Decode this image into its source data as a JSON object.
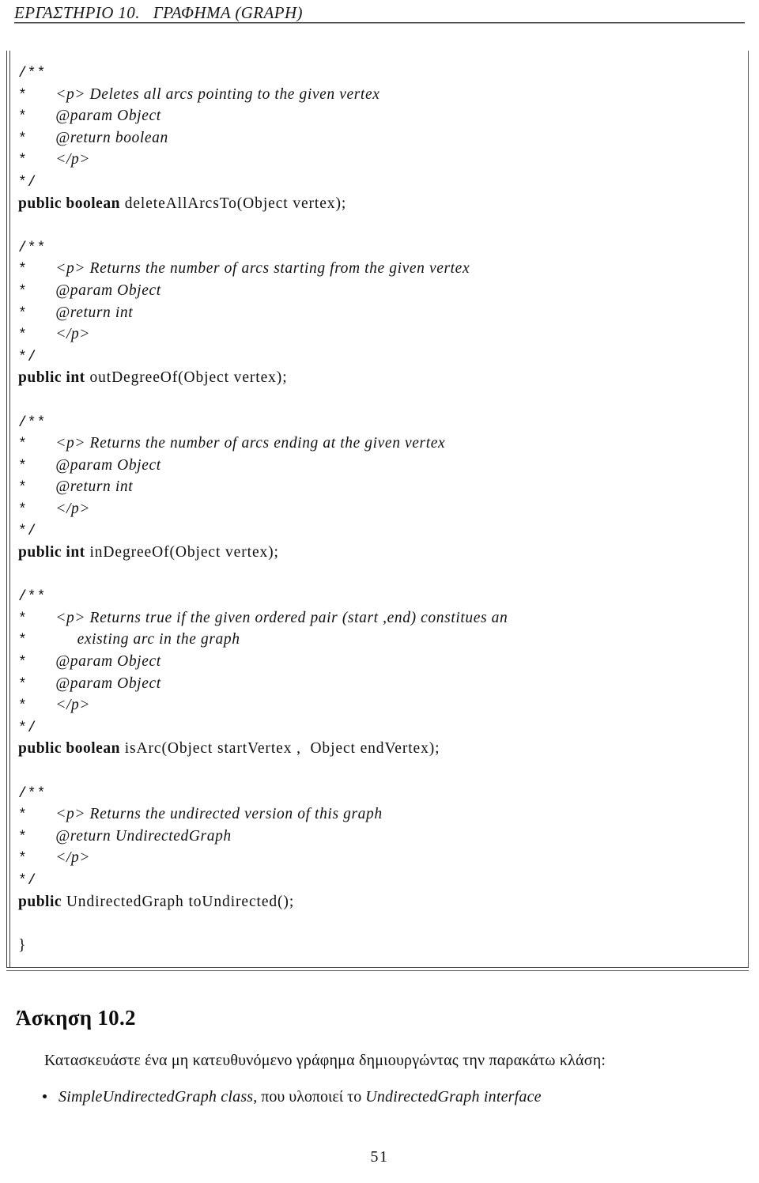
{
  "header": {
    "title": "ΕΡΓΑΣΤΗΡΙΟ 10.   ΓΡΑΦΗΜΑ (GRAPH)"
  },
  "code": {
    "blocks": [
      {
        "comment": [
          {
            "delim": "/**",
            "text": ""
          },
          {
            "delim": "*",
            "text": "<p> Deletes all arcs pointing to the given vertex"
          },
          {
            "delim": "*",
            "text": "@param Object"
          },
          {
            "delim": "*",
            "text": "@return boolean"
          },
          {
            "delim": "*",
            "text": "</p>"
          },
          {
            "delim": "*/",
            "text": ""
          }
        ],
        "signature": {
          "keywords": "public boolean",
          "declaration": "deleteAllArcsTo(Object vertex);"
        }
      },
      {
        "comment": [
          {
            "delim": "/**",
            "text": ""
          },
          {
            "delim": "*",
            "text": "<p> Returns the number of arcs starting from the given vertex"
          },
          {
            "delim": "*",
            "text": "@param Object"
          },
          {
            "delim": "*",
            "text": "@return int"
          },
          {
            "delim": "*",
            "text": "</p>"
          },
          {
            "delim": "*/",
            "text": ""
          }
        ],
        "signature": {
          "keywords": "public int",
          "declaration": "outDegreeOf(Object vertex);"
        }
      },
      {
        "comment": [
          {
            "delim": "/**",
            "text": ""
          },
          {
            "delim": "*",
            "text": "<p> Returns the number of arcs ending at the given vertex"
          },
          {
            "delim": "*",
            "text": "@param Object"
          },
          {
            "delim": "*",
            "text": "@return int"
          },
          {
            "delim": "*",
            "text": "</p>"
          },
          {
            "delim": "*/",
            "text": ""
          }
        ],
        "signature": {
          "keywords": "public int",
          "declaration": "inDegreeOf(Object vertex);"
        }
      },
      {
        "comment": [
          {
            "delim": "/**",
            "text": ""
          },
          {
            "delim": "*",
            "text": "<p> Returns true if the given ordered pair (start ,end) constitues an"
          },
          {
            "delim": "*",
            "text": "     existing arc in the graph"
          },
          {
            "delim": "*",
            "text": "@param Object"
          },
          {
            "delim": "*",
            "text": "@param Object"
          },
          {
            "delim": "*",
            "text": "</p>"
          },
          {
            "delim": "*/",
            "text": ""
          }
        ],
        "signature": {
          "keywords": "public boolean",
          "declaration": "isArc(Object startVertex ,  Object endVertex);"
        }
      },
      {
        "comment": [
          {
            "delim": "/**",
            "text": ""
          },
          {
            "delim": "*",
            "text": "<p> Returns the undirected version of this graph"
          },
          {
            "delim": "*",
            "text": "@return UndirectedGraph"
          },
          {
            "delim": "*",
            "text": "</p>"
          },
          {
            "delim": "*/",
            "text": ""
          }
        ],
        "signature": {
          "keywords": "public",
          "declaration": "UndirectedGraph toUndirected();"
        }
      }
    ],
    "closing_brace": "}"
  },
  "exercise": {
    "heading": "Άσκηση 10.2",
    "intro": "Κατασκευάστε ένα μη κατευθυνόμενο γράφημα δημιουργώντας την παρακάτω κλάση:",
    "items": [
      {
        "part1": "SimpleUndirectedGraph class",
        "part2": ", που υλοποιεί το ",
        "part3": "UndirectedGraph interface"
      }
    ]
  },
  "footer": {
    "page_number": "51"
  }
}
